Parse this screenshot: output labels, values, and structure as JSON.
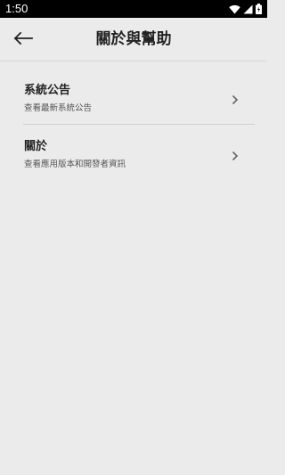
{
  "status_bar": {
    "time": "1:50",
    "icons": [
      "wifi-icon",
      "signal-icon",
      "battery-icon"
    ]
  },
  "header": {
    "back_icon": "arrow-left-icon",
    "title": "關於與幫助"
  },
  "menu": {
    "items": [
      {
        "title": "系統公告",
        "subtitle": "查看最新系統公告",
        "icon": "chevron-right-icon"
      },
      {
        "title": "關於",
        "subtitle": "查看應用版本和開發者資訊",
        "icon": "chevron-right-icon"
      }
    ]
  },
  "colors": {
    "background": "#ebebeb",
    "status_bar": "#000000",
    "text_primary": "#222222",
    "text_secondary": "#555555",
    "divider": "#d0d0d0"
  }
}
